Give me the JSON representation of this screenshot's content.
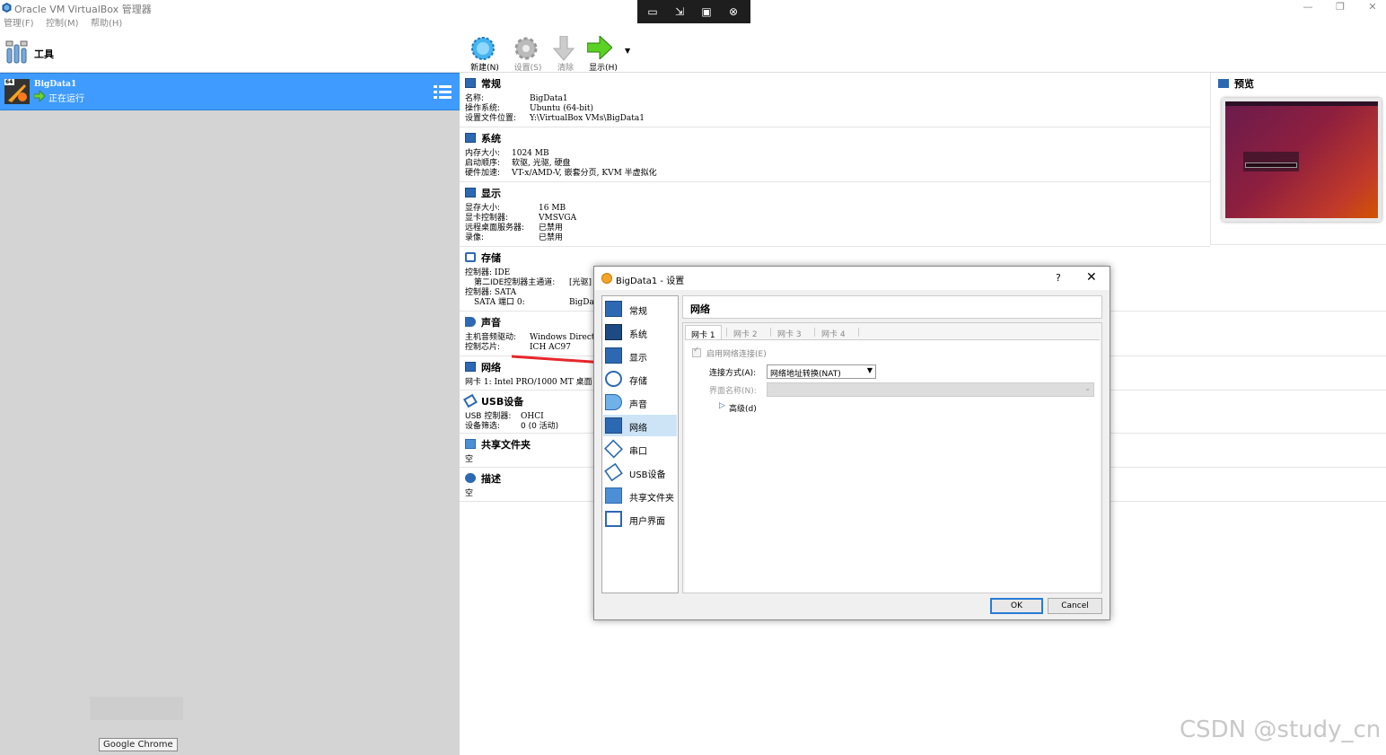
{
  "window": {
    "title": "Oracle VM VirtualBox 管理器",
    "minimize": "—",
    "restore": "❐",
    "close": "✕"
  },
  "menu": [
    "管理(F)",
    "控制(M)",
    "帮助(H)"
  ],
  "left": {
    "tools_label": "工具",
    "vm_name": "BigData1",
    "vm_state": "正在运行",
    "vm_badge": "64",
    "chrome_tip": "Google Chrome"
  },
  "toolbar": {
    "new": "新建(N)",
    "settings": "设置(S)",
    "discard": "清除",
    "show": "显示(H)"
  },
  "details": {
    "general": {
      "title": "常规",
      "name_label": "名称:",
      "name": "BigData1",
      "os_label": "操作系统:",
      "os": "Ubuntu (64-bit)",
      "loc_label": "设置文件位置:",
      "loc": "Y:\\VirtualBox VMs\\BigData1"
    },
    "system": {
      "title": "系统",
      "mem_label": "内存大小:",
      "mem": "1024 MB",
      "boot_label": "启动顺序:",
      "boot": "软驱, 光驱, 硬盘",
      "accel_label": "硬件加速:",
      "accel": "VT-x/AMD-V, 嵌套分页, KVM 半虚拟化"
    },
    "display": {
      "title": "显示",
      "vram_label": "显存大小:",
      "vram": "16 MB",
      "ctrl_label": "显卡控制器:",
      "ctrl": "VMSVGA",
      "rdp_label": "远程桌面服务器:",
      "rdp": "已禁用",
      "rec_label": "录像:",
      "rec": "已禁用"
    },
    "storage": {
      "title": "存储",
      "line1": "控制器: IDE",
      "line2_label": "第二IDE控制器主通道:",
      "line2": "[光驱]",
      "line3": "控制器: SATA",
      "line4_label": "SATA 端口 0:",
      "line4": "BigDat"
    },
    "audio": {
      "title": "声音",
      "host_label": "主机音频驱动:",
      "host": "Windows DirectS",
      "chip_label": "控制芯片:",
      "chip": "ICH AC97"
    },
    "network": {
      "title": "网络",
      "nic1": "网卡 1:  Intel PRO/1000 MT 桌面"
    },
    "usb": {
      "title": "USB设备",
      "ctrl_label": "USB 控制器:",
      "ctrl": "OHCI",
      "filter_label": "设备筛选:",
      "filter": "0 (0 活动)"
    },
    "shared": {
      "title": "共享文件夹",
      "value": "空"
    },
    "desc": {
      "title": "描述",
      "value": "空"
    },
    "preview_title": "预览"
  },
  "dialog": {
    "title": "BigData1 - 设置",
    "help": "?",
    "close": "✕",
    "nav": [
      "常规",
      "系统",
      "显示",
      "存储",
      "声音",
      "网络",
      "串口",
      "USB设备",
      "共享文件夹",
      "用户界面"
    ],
    "page_title": "网络",
    "tabs": [
      "网卡 1",
      "网卡 2",
      "网卡 3",
      "网卡 4"
    ],
    "enable_label": "启用网络连接(E)",
    "attach_label": "连接方式(A):",
    "attach_value": "网络地址转换(NAT)",
    "name_label": "界面名称(N):",
    "advanced": "高级(d)",
    "ok": "OK",
    "cancel": "Cancel"
  },
  "watermark": "CSDN @study_cn",
  "colors": {
    "selection": "#3f9bff",
    "arrow": "#e8262a",
    "nav_selected": "#cde4f7"
  }
}
